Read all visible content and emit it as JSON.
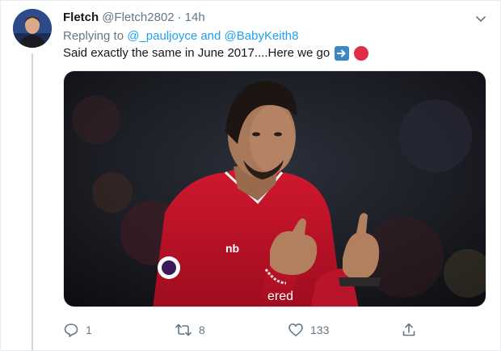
{
  "tweet": {
    "author_name": "Fletch",
    "author_handle": "@Fletch2802",
    "separator": "·",
    "timestamp": "14h",
    "replying_prefix": "Replying to",
    "replying_mention_1": "@_pauljoyce",
    "replying_conjunction": "and",
    "replying_mention_2": "@BabyKeith8",
    "text": "Said exactly the same in June 2017....Here we go",
    "emojis": [
      "right-arrow-emoji",
      "red-circle-emoji"
    ]
  },
  "media": {
    "description_icon": "photo",
    "jersey_text": "ered",
    "kit_brand": "nb"
  },
  "actions": {
    "reply_count": "1",
    "retweet_count": "8",
    "like_count": "133"
  },
  "colors": {
    "link": "#1da1f2",
    "muted": "#657786",
    "text": "#14171a",
    "shirt": "#c8102e"
  }
}
